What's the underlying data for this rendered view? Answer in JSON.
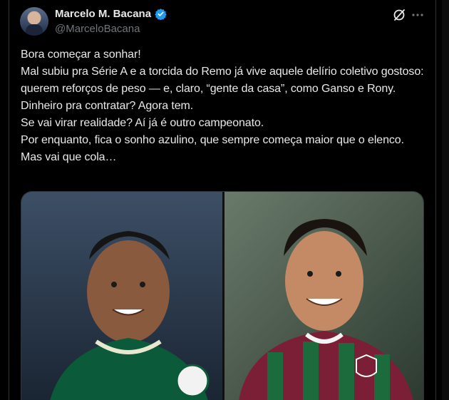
{
  "author": {
    "display_name": "Marcelo M. Bacana",
    "handle": "@MarceloBacana",
    "verified": true
  },
  "icons": {
    "verified": "verified-badge-icon",
    "grok": "grok-icon",
    "more": "more-options-icon"
  },
  "tweet": {
    "lines": [
      "Bora começar a sonhar!",
      "Mal subiu pra Série A e a torcida do Remo já vive aquele delírio coletivo gostoso: querem reforços de peso — e, claro, “gente da casa”, como Ganso e Rony.",
      "Dinheiro pra contratar? Agora tem.",
      "Se vai virar realidade? Aí já é outro campeonato.",
      "Por enquanto, fica o sonho azulino, que sempre começa maior que o elenco. Mas vai que cola…"
    ]
  },
  "colors": {
    "background": "#000000",
    "text": "#e7e9ea",
    "secondary": "#71767b",
    "verified": "#1d9bf0",
    "palmeiras_green": "#0b5a3a",
    "fluminense_maroon": "#7a1f35",
    "fluminense_green": "#1c6b3d"
  }
}
